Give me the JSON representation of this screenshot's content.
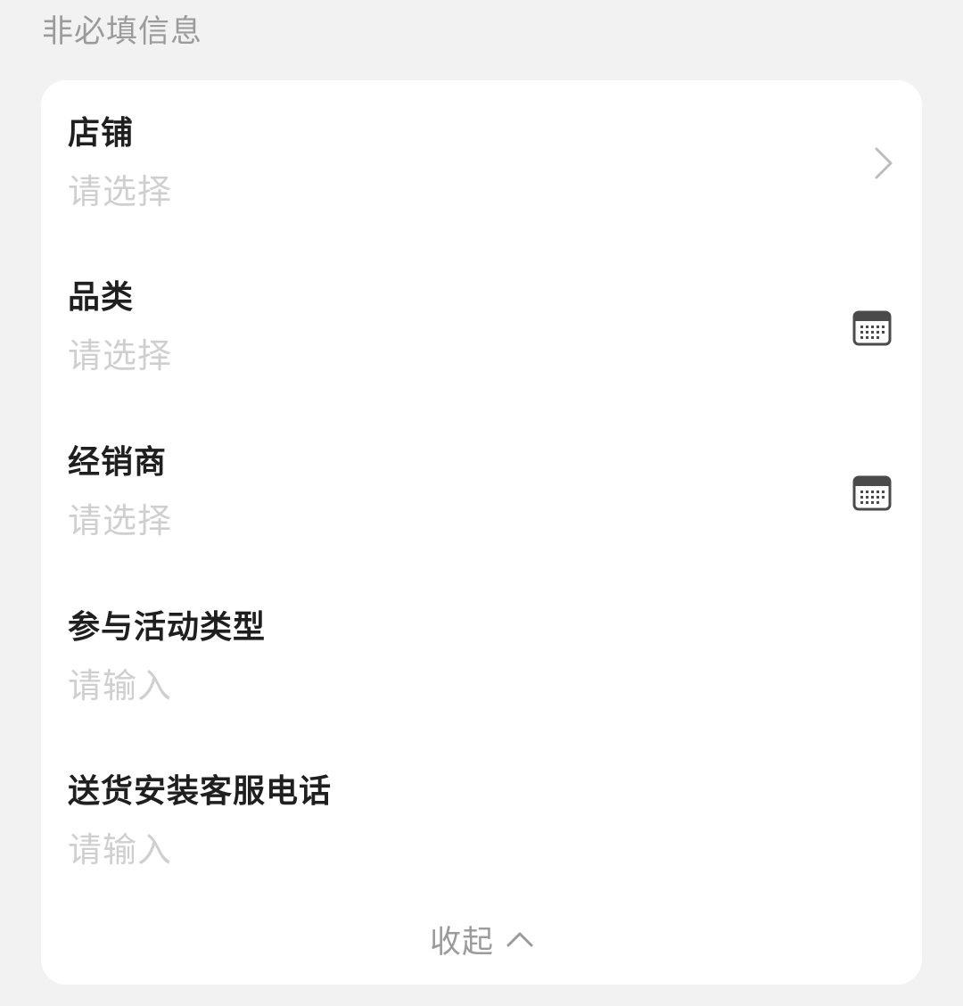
{
  "section": {
    "title": "非必填信息"
  },
  "fields": [
    {
      "label": "店铺",
      "placeholder": "请选择",
      "icon": "chevron-right-icon"
    },
    {
      "label": "品类",
      "placeholder": "请选择",
      "icon": "calendar-icon"
    },
    {
      "label": "经销商",
      "placeholder": "请选择",
      "icon": "calendar-icon"
    },
    {
      "label": "参与活动类型",
      "placeholder": "请输入",
      "icon": ""
    },
    {
      "label": "送货安装客服电话",
      "placeholder": "请输入",
      "icon": ""
    }
  ],
  "collapse": {
    "label": "收起",
    "icon": "chevron-up-icon"
  },
  "colors": {
    "background": "#f2f2f2",
    "card": "#ffffff",
    "label": "#1f1f1f",
    "placeholder": "#cfcfcf",
    "muted": "#9b9b9b",
    "icon": "#4a4a4a"
  }
}
